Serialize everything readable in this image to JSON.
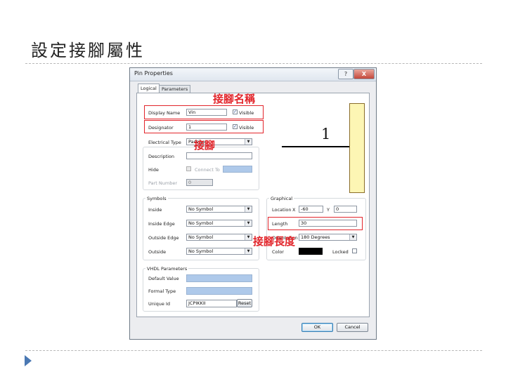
{
  "slide": {
    "title": "設定接腳屬性"
  },
  "dialog": {
    "title": "Pin Properties",
    "help_label": "?",
    "close_label": "X",
    "tabs": [
      "Logical",
      "Parameters"
    ],
    "display_name_label": "Display Name",
    "display_name_value": "Vin",
    "designator_label": "Designator",
    "designator_value": "1",
    "visible_label": "Visible",
    "electrical_type_label": "Electrical Type",
    "electrical_type_value": "Passive",
    "description_label": "Description",
    "hide_label": "Hide",
    "connect_to_label": "Connect To",
    "part_number_label": "Part Number",
    "part_number_value": "0",
    "symbols": {
      "title": "Symbols",
      "rows": [
        {
          "label": "Inside",
          "value": "No Symbol"
        },
        {
          "label": "Inside Edge",
          "value": "No Symbol"
        },
        {
          "label": "Outside Edge",
          "value": "No Symbol"
        },
        {
          "label": "Outside",
          "value": "No Symbol"
        }
      ]
    },
    "vhdl": {
      "title": "VHDL Parameters",
      "default_value_label": "Default Value",
      "formal_type_label": "Formal Type",
      "unique_id_label": "Unique Id",
      "unique_id_value": "JCPIKKII",
      "reset_label": "Reset"
    },
    "graphical": {
      "title": "Graphical",
      "location_label": "Location",
      "x_label": "X",
      "x_value": "-60",
      "y_label": "Y",
      "y_value": "0",
      "length_label": "Length",
      "length_value": "30",
      "orientation_label": "Orientation",
      "orientation_value": "180 Degrees",
      "color_label": "Color",
      "locked_label": "Locked"
    },
    "preview": {
      "pin_number": "1"
    },
    "ok_label": "OK",
    "cancel_label": "Cancel"
  },
  "annotations": {
    "pin_name": "接腳名稱",
    "pin": "接腳",
    "pin_length": "接腳長度"
  },
  "colors": {
    "annotation": "#e2252b",
    "preview_body": "#fdf6b4"
  }
}
